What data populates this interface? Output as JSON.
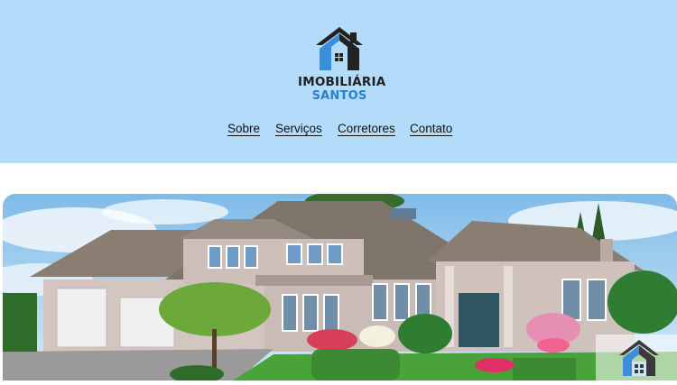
{
  "brand": {
    "line1": "IMOBILIÁRIA",
    "line2": "SANTOS",
    "logo_icon": "house-logo-icon",
    "colors": {
      "dark": "#222222",
      "blue": "#3a8fdc"
    }
  },
  "nav": {
    "items": [
      {
        "label": "Sobre"
      },
      {
        "label": "Serviços"
      },
      {
        "label": "Corretores"
      },
      {
        "label": "Contato"
      }
    ]
  },
  "hero": {
    "image": "house-exterior-photo",
    "colors": {
      "sky": "#a9d3f2",
      "roof": "#8a7e73",
      "walls": "#cfc2bc",
      "lawn": "#4aa33a"
    }
  },
  "colors": {
    "header_bg": "#b3dcfb",
    "page_bg": "#ffffff"
  }
}
